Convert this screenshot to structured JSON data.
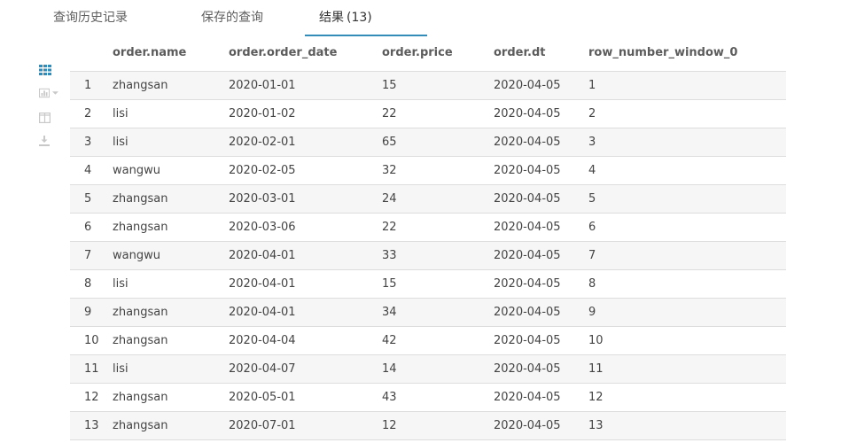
{
  "tabs": {
    "history": "查询历史记录",
    "saved": "保存的查询",
    "results": "结果",
    "results_count": "(13)"
  },
  "colors": {
    "accent": "#338bb8",
    "grid_icon": "#338bb8",
    "inactive_icon": "#c8c8c8"
  },
  "sidebar": {
    "icons": [
      "grid-view-icon",
      "chart-icon",
      "columns-icon",
      "download-icon"
    ]
  },
  "results": {
    "columns": [
      "order.name",
      "order.order_date",
      "order.price",
      "order.dt",
      "row_number_window_0"
    ],
    "rows": [
      {
        "n": "1",
        "name": "zhangsan",
        "date": "2020-01-01",
        "price": "15",
        "dt": "2020-04-05",
        "rn": "1"
      },
      {
        "n": "2",
        "name": "lisi",
        "date": "2020-01-02",
        "price": "22",
        "dt": "2020-04-05",
        "rn": "2"
      },
      {
        "n": "3",
        "name": "lisi",
        "date": "2020-02-01",
        "price": "65",
        "dt": "2020-04-05",
        "rn": "3"
      },
      {
        "n": "4",
        "name": "wangwu",
        "date": "2020-02-05",
        "price": "32",
        "dt": "2020-04-05",
        "rn": "4"
      },
      {
        "n": "5",
        "name": "zhangsan",
        "date": "2020-03-01",
        "price": "24",
        "dt": "2020-04-05",
        "rn": "5"
      },
      {
        "n": "6",
        "name": "zhangsan",
        "date": "2020-03-06",
        "price": "22",
        "dt": "2020-04-05",
        "rn": "6"
      },
      {
        "n": "7",
        "name": "wangwu",
        "date": "2020-04-01",
        "price": "33",
        "dt": "2020-04-05",
        "rn": "7"
      },
      {
        "n": "8",
        "name": "lisi",
        "date": "2020-04-01",
        "price": "15",
        "dt": "2020-04-05",
        "rn": "8"
      },
      {
        "n": "9",
        "name": "zhangsan",
        "date": "2020-04-01",
        "price": "34",
        "dt": "2020-04-05",
        "rn": "9"
      },
      {
        "n": "10",
        "name": "zhangsan",
        "date": "2020-04-04",
        "price": "42",
        "dt": "2020-04-05",
        "rn": "10"
      },
      {
        "n": "11",
        "name": "lisi",
        "date": "2020-04-07",
        "price": "14",
        "dt": "2020-04-05",
        "rn": "11"
      },
      {
        "n": "12",
        "name": "zhangsan",
        "date": "2020-05-01",
        "price": "43",
        "dt": "2020-04-05",
        "rn": "12"
      },
      {
        "n": "13",
        "name": "zhangsan",
        "date": "2020-07-01",
        "price": "12",
        "dt": "2020-04-05",
        "rn": "13"
      }
    ]
  }
}
